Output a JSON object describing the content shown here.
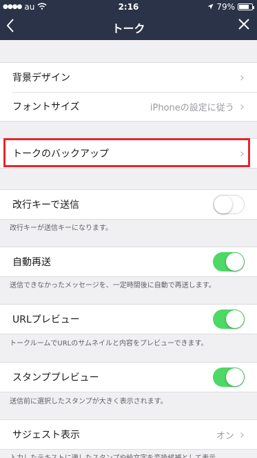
{
  "status_bar": {
    "carrier": "au",
    "time": "2:16",
    "battery_percent": "79%",
    "battery_level": 0.79
  },
  "nav": {
    "title": "トーク",
    "back_icon": "chevron-left-icon",
    "close_icon": "close-icon"
  },
  "groups": {
    "background_design": "背景デザイン",
    "font_size": "フォントサイズ",
    "font_size_value": "iPhoneの設定に従う",
    "talk_backup": "トークのバックアップ",
    "return_key_send": "改行キーで送信",
    "return_key_send_hint": "改行キーが送信キーになります。",
    "auto_resend": "自動再送",
    "auto_resend_hint": "送信できなかったメッセージを、一定時間後に自動で再送します。",
    "url_preview": "URLプレビュー",
    "url_preview_hint": "トークルームでURLのサムネイルと内容をプレビューできます。",
    "sticker_preview": "スタンププレビュー",
    "sticker_preview_hint": "送信前に選択したスタンプが大きく表示されます。",
    "suggest": "サジェスト表示",
    "suggest_value": "オン",
    "suggest_hint": "入力したテキストに適したスタンプや絵文字を変換候補として表示"
  },
  "toggles": {
    "return_key_send": false,
    "auto_resend": true,
    "url_preview": true,
    "sticker_preview": true
  },
  "colors": {
    "nav_background": "#2a3347",
    "toggle_on": "#4cd964",
    "highlight": "#e8232d"
  }
}
